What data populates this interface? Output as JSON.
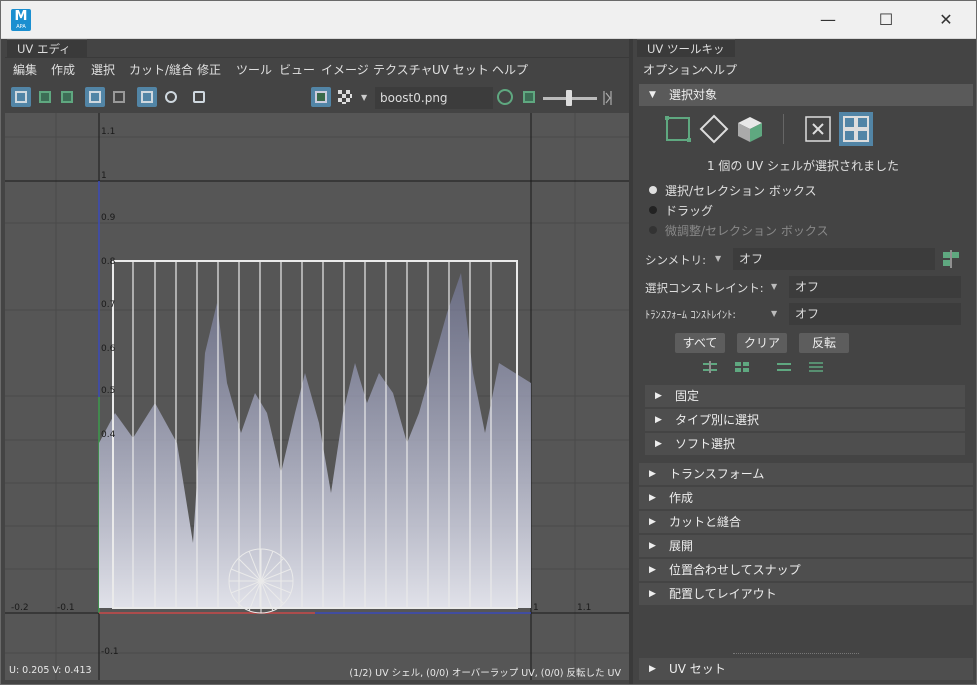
{
  "window": {
    "app_icon_letter": "M",
    "app_icon_sub": "APA",
    "minimize": "—",
    "maximize": "☐",
    "close": "✕"
  },
  "uv_editor": {
    "tab": "UV エディタ",
    "menu": [
      "編集",
      "作成",
      "選択",
      "カット/縫合",
      "修正",
      "ツール",
      "ビュー",
      "イメージ",
      "テクスチャ",
      "UV セット",
      "ヘルプ"
    ],
    "texture_name": "boost0.png",
    "axis_labels": {
      "y": [
        "1.1",
        "1",
        "0.9",
        "0.8",
        "0.7",
        "0.6",
        "0.5",
        "0.4"
      ],
      "x": [
        "-0.2",
        "-0.1",
        "1",
        "1.1"
      ],
      "y_neg": "-0.1"
    },
    "status_left": "U:  0.205 V:  0.413",
    "status_right": "(1/2) UV シェル, (0/0) オーバーラップ UV, (0/0) 反転した UV"
  },
  "toolkit": {
    "tab": "UV ツールキット",
    "menu": [
      "オプション",
      "ヘルプ"
    ],
    "selection_header": "選択対象",
    "selection_status": "1 個の UV シェルが選択されました",
    "radios": [
      {
        "label": "選択/セレクション ボックス",
        "selected": true,
        "disabled": false
      },
      {
        "label": "ドラッグ",
        "selected": false,
        "disabled": false
      },
      {
        "label": "微調整/セレクション ボックス",
        "selected": false,
        "disabled": true
      }
    ],
    "symmetry": {
      "label": "シンメトリ:",
      "value": "オフ"
    },
    "selection_constraint": {
      "label": "選択コンストレイント:",
      "value": "オフ"
    },
    "transform_constraint": {
      "label": "ﾄﾗﾝｽﾌｫｰﾑ ｺﾝｽﾄﾚｲﾝﾄ:",
      "value": "オフ"
    },
    "buttons": {
      "all": "すべて",
      "clear": "クリア",
      "invert": "反転"
    },
    "sub_sections": [
      "固定",
      "タイプ別に選択",
      "ソフト選択"
    ],
    "sections": [
      "トランスフォーム",
      "作成",
      "カットと縫合",
      "展開",
      "位置合わせしてスナップ",
      "配置してレイアウト"
    ],
    "uv_set_header": "UV セット"
  },
  "colors": {
    "accent": "#5285a6",
    "green": "#5fa880"
  }
}
